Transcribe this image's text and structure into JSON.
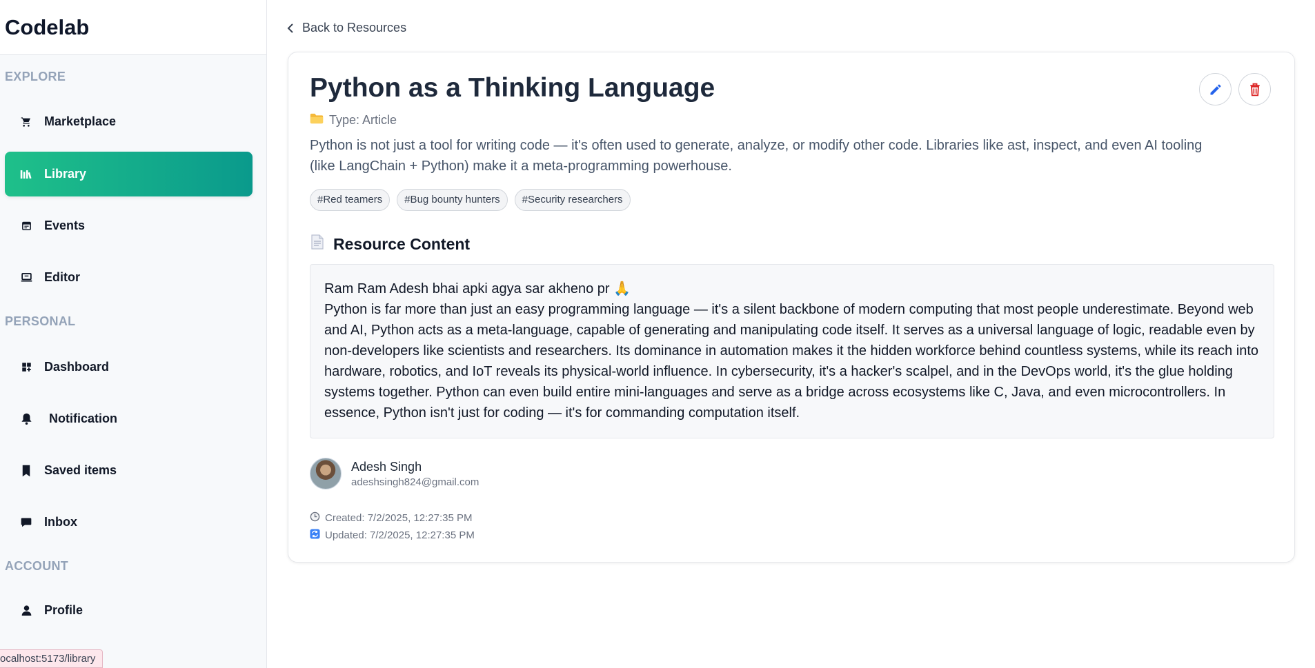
{
  "app": {
    "brand": "Codelab"
  },
  "sidebar": {
    "sections": {
      "explore": "EXPLORE",
      "personal": "PERSONAL",
      "account": "ACCOUNT"
    },
    "items": {
      "marketplace": "Marketplace",
      "library": "Library",
      "events": "Events",
      "editor": "Editor",
      "dashboard": "Dashboard",
      "notification": "Notification",
      "saved": "Saved items",
      "inbox": "Inbox",
      "profile": "Profile"
    },
    "active_item": "Library",
    "active_gradient": [
      "#1fc08a",
      "#0a9a8c"
    ]
  },
  "status_url": "ocalhost:5173/library",
  "main": {
    "back_label": "Back to Resources",
    "title": "Python as a Thinking Language",
    "type_label": "Type: Article",
    "description": "Python is not just a tool for writing code — it's often used to generate, analyze, or modify other code. Libraries like ast, inspect, and even AI tooling (like LangChain + Python) make it a meta-programming powerhouse.",
    "tags": [
      "#Red teamers",
      "#Bug bounty hunters",
      "#Security researchers"
    ],
    "content_heading": "Resource Content",
    "content_greeting": "Ram Ram Adesh bhai apki agya sar akheno pr 🙏",
    "content_body": "Python is far more than just an easy programming language — it's a silent backbone of modern computing that most people underestimate. Beyond web and AI, Python acts as a meta-language, capable of generating and manipulating code itself. It serves as a universal language of logic, readable even by non-developers like scientists and researchers. Its dominance in automation makes it the hidden workforce behind countless systems, while its reach into hardware, robotics, and IoT reveals its physical-world influence. In cybersecurity, it's a hacker's scalpel, and in the DevOps world, it's the glue holding systems together. Python can even build entire mini-languages and serve as a bridge across ecosystems like C, Java, and even microcontrollers. In essence, Python isn't just for coding — it's for commanding computation itself.",
    "author": {
      "name": "Adesh Singh",
      "email": "adeshsingh824@gmail.com"
    },
    "created": "Created: 7/2/2025, 12:27:35 PM",
    "updated": "Updated: 7/2/2025, 12:27:35 PM",
    "icons": {
      "edit": "pencil-icon",
      "delete": "trash-icon",
      "type": "folder-icon",
      "content": "document-icon",
      "created": "clock-icon",
      "updated": "refresh-icon"
    },
    "colors": {
      "edit": "#2563eb",
      "delete": "#dc2626"
    }
  }
}
